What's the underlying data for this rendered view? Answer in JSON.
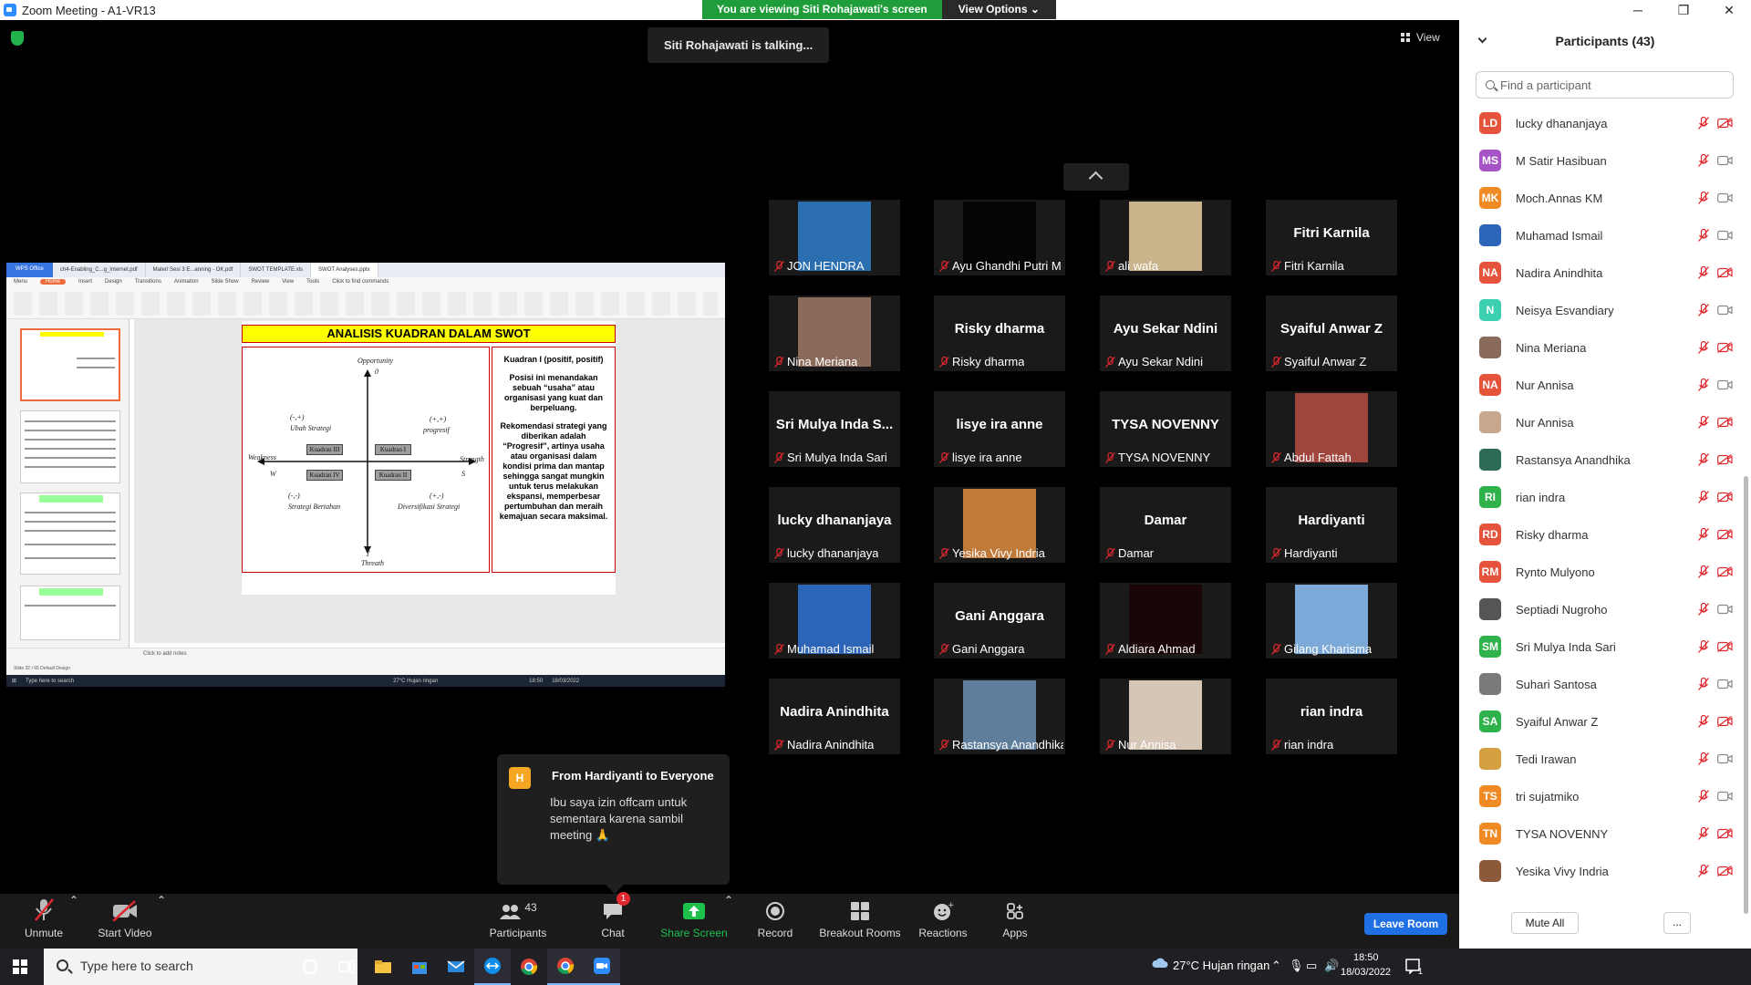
{
  "window": {
    "title": "Zoom Meeting - A1-VR13",
    "minimize": "─",
    "maximize": "❐",
    "close": "✕"
  },
  "banner": {
    "viewing": "You are viewing Siti Rohajawati's screen",
    "view_options": "View Options ⌄"
  },
  "talking": "Siti Rohajawati is talking...",
  "view_label": "View",
  "shared_screen": {
    "app_tabs": [
      "WPS Office",
      "ch4-Enabling_C...g_Internet.pdf",
      "Materi Sesi 3 E...anning - OK.pdf",
      "SWOT TEMPLATE.xls",
      "SWOT Analyses.pptx"
    ],
    "menus": [
      "Menu",
      "Home",
      "Insert",
      "Design",
      "Transitions",
      "Animation",
      "Slide Show",
      "Review",
      "View",
      "Tools",
      "Click to find commands"
    ],
    "slide_title": "ANALISIS  KUADRAN DALAM SWOT",
    "quadrant": {
      "opportunity": "Opportunity",
      "zero": "0",
      "threat": "Threath",
      "t": "T",
      "weakness": "Weakness",
      "w": "W",
      "strength": "Strength",
      "s": "S",
      "q1": "Kuadran I",
      "q2": "Kuadran II",
      "q3": "Kuadran III",
      "q4": "Kuadran IV",
      "ubah": "Ubah Strategi",
      "ubah_sign": "(-,+)",
      "progresif": "progresif",
      "progresif_sign": "(+,+)",
      "bertahan": "Strategi Bertahan",
      "bertahan_sign": "(-,-)",
      "diversifikasi": "Diversifikasi Strategi",
      "diversifikasi_sign": "(+,-)"
    },
    "desc_heading": "Kuadran I (positif, positif)",
    "desc_p1": "Posisi ini menandakan sebuah “usaha” atau organisasi yang kuat dan berpeluang.",
    "desc_p2": "Rekomendasi strategi yang diberikan adalah “Progresif”, artinya usaha atau organisasi dalam kondisi prima dan mantap sehingga sangat mungkin untuk terus melakukan ekspansi, memperbesar pertumbuhan dan meraih kemajuan secara maksimal.",
    "notes": "Click to add notes",
    "status_left": "Slide 32 / 65   Default Design",
    "taskbar_search": "Type here to search",
    "weather": "27°C  Hujan ringan",
    "time": "18:50",
    "date": "18/03/2022"
  },
  "tiles": [
    {
      "name": "JON HENDRA",
      "big": "",
      "pic": "#2b6fb0"
    },
    {
      "name": "Ayu Ghandhi Putri M",
      "big": "",
      "pic": "#050505"
    },
    {
      "name": "ali wafa",
      "big": "",
      "pic": "#c9b48c"
    },
    {
      "name": "Fitri Karnila",
      "big": "Fitri Karnila",
      "pic": ""
    },
    {
      "name": "Nina Meriana",
      "big": "",
      "pic": "#8a6a5a"
    },
    {
      "name": "Risky dharma",
      "big": "Risky dharma",
      "pic": ""
    },
    {
      "name": "Ayu Sekar Ndini",
      "big": "Ayu Sekar Ndini",
      "pic": ""
    },
    {
      "name": "Syaiful Anwar Z",
      "big": "Syaiful Anwar Z",
      "pic": ""
    },
    {
      "name": "Sri Mulya Inda Sari",
      "big": "Sri Mulya Inda S...",
      "pic": ""
    },
    {
      "name": "lisye ira anne",
      "big": "lisye ira anne",
      "pic": ""
    },
    {
      "name": "TYSA NOVENNY",
      "big": "TYSA NOVENNY",
      "pic": ""
    },
    {
      "name": "Abdul Fattah",
      "big": "",
      "pic": "#a0463c"
    },
    {
      "name": "lucky dhananjaya",
      "big": "lucky dhananjaya",
      "pic": ""
    },
    {
      "name": "Yesika Vivy Indria",
      "big": "",
      "pic": "#c07a3a"
    },
    {
      "name": "Damar",
      "big": "Damar",
      "pic": ""
    },
    {
      "name": "Hardiyanti",
      "big": "Hardiyanti",
      "pic": ""
    },
    {
      "name": "Muhamad Ismail",
      "big": "",
      "pic": "#2c64b8"
    },
    {
      "name": "Gani Anggara",
      "big": "Gani Anggara",
      "pic": ""
    },
    {
      "name": "Aldiara Ahmad",
      "big": "",
      "pic": "#1a0606"
    },
    {
      "name": "Gilang Kharisma",
      "big": "",
      "pic": "#7da9d8"
    },
    {
      "name": "Nadira Anindhita",
      "big": "Nadira Anindhita",
      "pic": ""
    },
    {
      "name": "Rastansya Anandhika",
      "big": "",
      "pic": "#5f7e9b"
    },
    {
      "name": "Nur Annisa",
      "big": "",
      "pic": "#d6c6b6"
    },
    {
      "name": "rian indra",
      "big": "rian indra",
      "pic": ""
    }
  ],
  "chat_popup": {
    "initial": "H",
    "from": "From Hardiyanti to Everyone",
    "message": "Ibu saya izin offcam untuk sementara karena sambil meeting 🙏"
  },
  "toolbar": {
    "unmute": "Unmute",
    "start_video": "Start Video",
    "participants": "Participants",
    "participants_count": "43",
    "chat": "Chat",
    "chat_badge": "1",
    "share_screen": "Share Screen",
    "record": "Record",
    "breakout": "Breakout Rooms",
    "reactions": "Reactions",
    "apps": "Apps",
    "leave": "Leave Room"
  },
  "panel": {
    "title": "Participants (43)",
    "search_placeholder": "Find a participant",
    "mute_all": "Mute All",
    "more": "...",
    "list": [
      {
        "initials": "LD",
        "name": "lucky dhananjaya",
        "color": "#e5533d",
        "video_off": true
      },
      {
        "initials": "MS",
        "name": "M Satir Hasibuan",
        "color": "#a553c7",
        "video_off": false
      },
      {
        "initials": "MK",
        "name": "Moch.Annas KM",
        "color": "#f08a24",
        "video_off": false
      },
      {
        "initials": "",
        "name": "Muhamad Ismail",
        "color": "#2c64b8",
        "video_off": false
      },
      {
        "initials": "NA",
        "name": "Nadira Anindhita",
        "color": "#e5533d",
        "video_off": true
      },
      {
        "initials": "N",
        "name": "Neisya Esvandiary",
        "color": "#3ccfb0",
        "video_off": false
      },
      {
        "initials": "",
        "name": "Nina Meriana",
        "color": "#8a6a5a",
        "video_off": true
      },
      {
        "initials": "NA",
        "name": "Nur Annisa",
        "color": "#e5533d",
        "video_off": false
      },
      {
        "initials": "",
        "name": "Nur Annisa",
        "color": "#c9a78c",
        "video_off": true
      },
      {
        "initials": "",
        "name": "Rastansya Anandhika",
        "color": "#2d6b57",
        "video_off": true
      },
      {
        "initials": "RI",
        "name": "rian indra",
        "color": "#2fb24c",
        "video_off": true
      },
      {
        "initials": "RD",
        "name": "Risky dharma",
        "color": "#e5533d",
        "video_off": true
      },
      {
        "initials": "RM",
        "name": "Rynto Mulyono",
        "color": "#e5533d",
        "video_off": true
      },
      {
        "initials": "",
        "name": "Septiadi Nugroho",
        "color": "#555555",
        "video_off": false
      },
      {
        "initials": "SM",
        "name": "Sri Mulya Inda Sari",
        "color": "#2fb24c",
        "video_off": true
      },
      {
        "initials": "",
        "name": "Suhari Santosa",
        "color": "#7a7a7a",
        "video_off": false
      },
      {
        "initials": "SA",
        "name": "Syaiful Anwar Z",
        "color": "#2fb24c",
        "video_off": true
      },
      {
        "initials": "",
        "name": "Tedi Irawan",
        "color": "#d4a042",
        "video_off": false
      },
      {
        "initials": "TS",
        "name": "tri sujatmiko",
        "color": "#f08a24",
        "video_off": false
      },
      {
        "initials": "TN",
        "name": "TYSA NOVENNY",
        "color": "#f08a24",
        "video_off": true
      },
      {
        "initials": "",
        "name": "Yesika Vivy Indria",
        "color": "#8c5a3a",
        "video_off": true
      }
    ]
  },
  "win_taskbar": {
    "search": "Type here to search",
    "weather": "27°C  Hujan ringan",
    "time": "18:50",
    "date": "18/03/2022",
    "notif": "1"
  }
}
